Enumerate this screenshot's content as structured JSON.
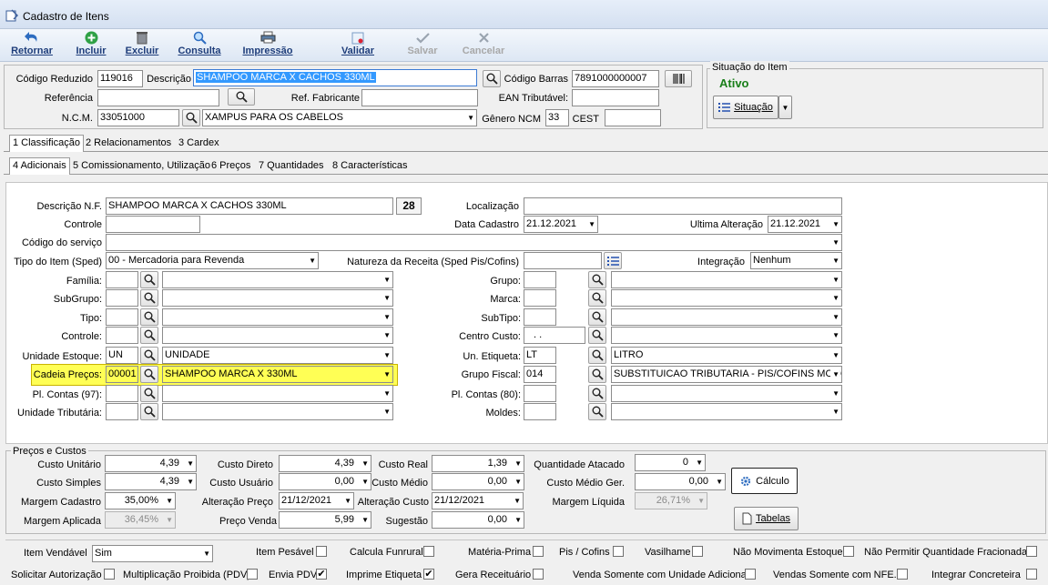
{
  "window": {
    "title": "Cadastro de Itens"
  },
  "toolbar": {
    "retornar": "Retornar",
    "incluir": "Incluir",
    "excluir": "Excluir",
    "consulta": "Consulta",
    "impressao": "Impressão",
    "validar": "Validar",
    "salvar": "Salvar",
    "cancelar": "Cancelar"
  },
  "header": {
    "codigo_reduzido_label": "Código Reduzido",
    "codigo_reduzido": "119016",
    "descricao_label": "Descrição",
    "descricao": "SHAMPOO MARCA X CACHOS 330ML",
    "codigo_barras_label": "Código Barras",
    "codigo_barras": "7891000000007",
    "referencia_label": "Referência",
    "referencia": "",
    "ref_fabricante_label": "Ref. Fabricante",
    "ref_fabricante": "",
    "ean_tributavel_label": "EAN Tributável:",
    "ean_tributavel": "",
    "ncm_label": "N.C.M.",
    "ncm": "33051000",
    "ncm_descricao": "XAMPUS PARA OS CABELOS",
    "genero_ncm_label": "Gênero NCM",
    "genero_ncm": "33",
    "cest_label": "CEST",
    "cest": ""
  },
  "situacao": {
    "group_label": "Situação do Item",
    "status": "Ativo",
    "status_color": "#1a7f1a",
    "button_label": "Situação"
  },
  "tabs": {
    "main": [
      "1 Classificação",
      "2 Relacionamentos",
      "3 Cardex"
    ],
    "sub": [
      "4 Adicionais",
      "5 Comissionamento, Utilização",
      "6 Preços",
      "7 Quantidades",
      "8 Características"
    ]
  },
  "adicionais": {
    "descricao_nf_label": "Descrição N.F.",
    "descricao_nf": "SHAMPOO MARCA X CACHOS 330ML",
    "descricao_nf_len": "28",
    "localizacao_label": "Localização",
    "localizacao": "",
    "controle_label": "Controle",
    "controle": "",
    "data_cadastro_label": "Data Cadastro",
    "data_cadastro": "21.12.2021",
    "ultima_alteracao_label": "Ultima Alteração",
    "ultima_alteracao": "21.12.2021",
    "codigo_servico_label": "Código do serviço",
    "codigo_servico": "",
    "tipo_item_label": "Tipo do Item (Sped)",
    "tipo_item": "00 - Mercadoria para Revenda",
    "natureza_receita_label": "Natureza da Receita (Sped Pis/Cofins)",
    "natureza_receita": "",
    "integracao_label": "Integração",
    "integracao": "Nenhum",
    "familia_label": "Família:",
    "subgrupo_label": "SubGrupo:",
    "tipo_label": "Tipo:",
    "controle2_label": "Controle:",
    "unidade_estoque_label": "Unidade Estoque:",
    "unidade_estoque_code": "UN",
    "unidade_estoque": "UNIDADE",
    "cadeia_precos_label": "Cadeia Preços:",
    "cadeia_precos_code": "00001",
    "cadeia_precos": "SHAMPOO MARCA X 330ML",
    "pl_contas_97_label": "Pl. Contas (97):",
    "unidade_tributaria_label": "Unidade Tributária:",
    "grupo_label": "Grupo:",
    "marca_label": "Marca:",
    "subtipo_label": "SubTipo:",
    "centro_custo_label": "Centro Custo:",
    "centro_custo": ".  .",
    "un_etiqueta_label": "Un. Etiqueta:",
    "un_etiqueta_code": "LT",
    "un_etiqueta": "LITRO",
    "grupo_fiscal_label": "Grupo Fiscal:",
    "grupo_fiscal_code": "014",
    "grupo_fiscal": "SUBSTITUICAO TRIBUTARIA - PIS/COFINS MONO",
    "pl_contas_80_label": "Pl. Contas (80):",
    "moldes_label": "Moldes:"
  },
  "precos": {
    "group_label": "Preços e Custos",
    "custo_unitario_label": "Custo Unitário",
    "custo_unitario": "4,39",
    "custo_simples_label": "Custo Simples",
    "custo_simples": "4,39",
    "margem_cadastro_label": "Margem Cadastro",
    "margem_cadastro": "35,00%",
    "margem_aplicada_label": "Margem Aplicada",
    "margem_aplicada": "36,45%",
    "custo_direto_label": "Custo Direto",
    "custo_direto": "4,39",
    "custo_usuario_label": "Custo Usuário",
    "custo_usuario": "0,00",
    "alteracao_preco_label": "Alteração Preço",
    "alteracao_preco": "21/12/2021",
    "preco_venda_label": "Preço Venda",
    "preco_venda": "5,99",
    "custo_real_label": "Custo Real",
    "custo_real": "1,39",
    "custo_medio_label": "Custo Médio",
    "custo_medio": "0,00",
    "alteracao_custo_label": "Alteração Custo",
    "alteracao_custo": "21/12/2021",
    "sugestao_label": "Sugestão",
    "sugestao": "0,00",
    "quantidade_atacado_label": "Quantidade Atacado",
    "quantidade_atacado": "0",
    "custo_medio_ger_label": "Custo Médio Ger.",
    "custo_medio_ger": "0,00",
    "margem_liquida_label": "Margem Líquida",
    "margem_liquida": "26,71%",
    "calculo_button": "Cálculo",
    "tabelas_button": "Tabelas"
  },
  "flags": {
    "item_vendavel_label": "Item Vendável",
    "item_vendavel": "Sim",
    "item_pesavel": "Item Pesável",
    "calcula_funrural": "Calcula Funrural",
    "materia_prima": "Matéria-Prima",
    "pis_cofins": "Pis / Cofins",
    "vasilhame": "Vasilhame",
    "nao_movimenta_estoque": "Não Movimenta Estoque",
    "nao_permitir_qtd_fracionada": "Não Permitir Quantidade Fracionada",
    "solicitar_autorizacao": "Solicitar Autorização",
    "multiplicacao_proibida": "Multiplicação Proibida (PDV)",
    "envia_pdv": "Envia PDV",
    "imprime_etiqueta": "Imprime Etiqueta",
    "gera_receituario": "Gera Receituário",
    "venda_somente_unidade_adicional": "Venda Somente com Unidade Adicional",
    "vendas_somente_nfe": "Vendas Somente com NFE.",
    "integrar_concreteira": "Integrar Concreteira",
    "checked_mark": "✔"
  },
  "colors": {
    "titlebar": "#dbe6f4",
    "highlight": "#ffff55",
    "selection": "#3399ff",
    "toolbar_text": "#1e3d7a"
  },
  "icons": [
    "window-icon",
    "back-arrow-icon",
    "plus-icon",
    "trash-icon",
    "magnifier-icon",
    "printer-icon",
    "validate-icon",
    "check-icon",
    "cross-icon",
    "barcode-icon",
    "list-icon",
    "gear-icon",
    "document-icon"
  ]
}
